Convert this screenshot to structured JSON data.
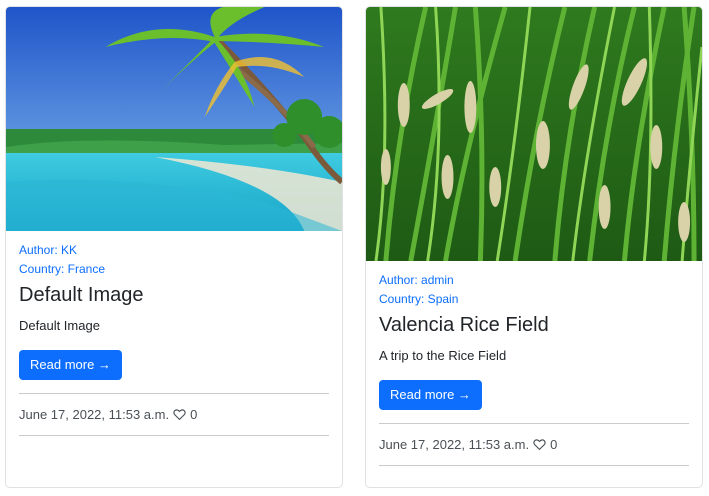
{
  "posts": [
    {
      "image_alt": "Tropical beach with palm trees",
      "author": "Author: KK",
      "country": "Country: France",
      "title": "Default Image",
      "description": "Default Image",
      "read_more": "Read more →",
      "date": "June 17, 2022, 11:53 a.m.",
      "likes": "0",
      "heart_icon": "heart-icon"
    },
    {
      "image_alt": "Rice field grass close-up",
      "author": "Author: admin",
      "country": "Country: Spain",
      "title": "Valencia Rice Field",
      "description": "A trip to the Rice Field",
      "read_more": "Read more →",
      "date": "June 17, 2022, 11:53 a.m.",
      "likes": "0",
      "heart_icon": "heart-icon"
    }
  ],
  "colors": {
    "link": "#0d6efd",
    "button": "#0d6efd",
    "text": "#212529",
    "muted": "#4a4f55"
  }
}
